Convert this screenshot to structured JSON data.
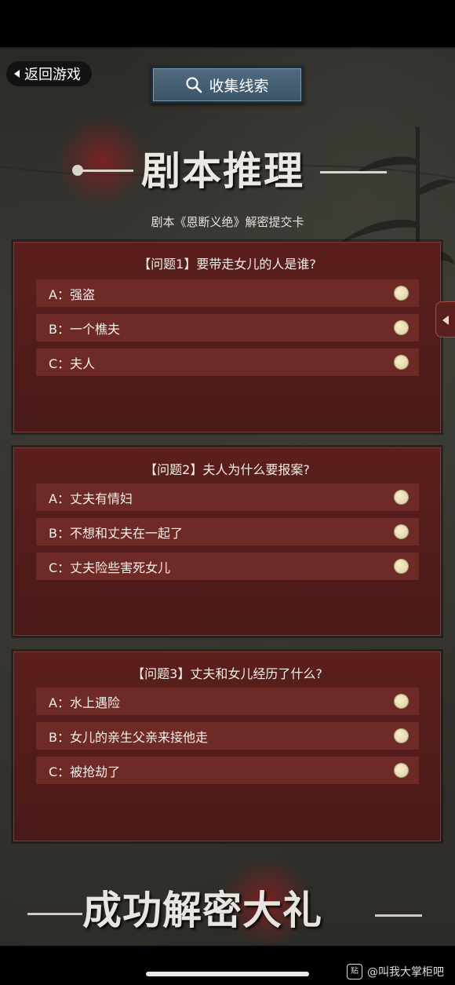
{
  "nav": {
    "back_label": "返回游戏",
    "clue_label": "收集线索"
  },
  "header": {
    "title": "剧本推理",
    "subtitle": "剧本《恩断义绝》解密提交卡"
  },
  "questions": [
    {
      "title": "【问题1】要带走女儿的人是谁?",
      "options": [
        "A：强盗",
        "B：一个樵夫",
        "C：夫人"
      ]
    },
    {
      "title": "【问题2】夫人为什么要报案?",
      "options": [
        "A：丈夫有情妇",
        "B：不想和丈夫在一起了",
        "C：丈夫险些害死女儿"
      ]
    },
    {
      "title": "【问题3】丈夫和女儿经历了什么?",
      "options": [
        "A：水上遇险",
        "B：女儿的亲生父亲来接他走",
        "C：被抢劫了"
      ]
    }
  ],
  "footer": {
    "banner": "成功解密大礼",
    "watermark": "@叫我大掌柜吧",
    "watermark_logo": "贴"
  },
  "colors": {
    "card": "#5b1f1d",
    "option": "#6e2a27",
    "radio": "#efe6bd",
    "clue_button": "#4f6a7f"
  }
}
